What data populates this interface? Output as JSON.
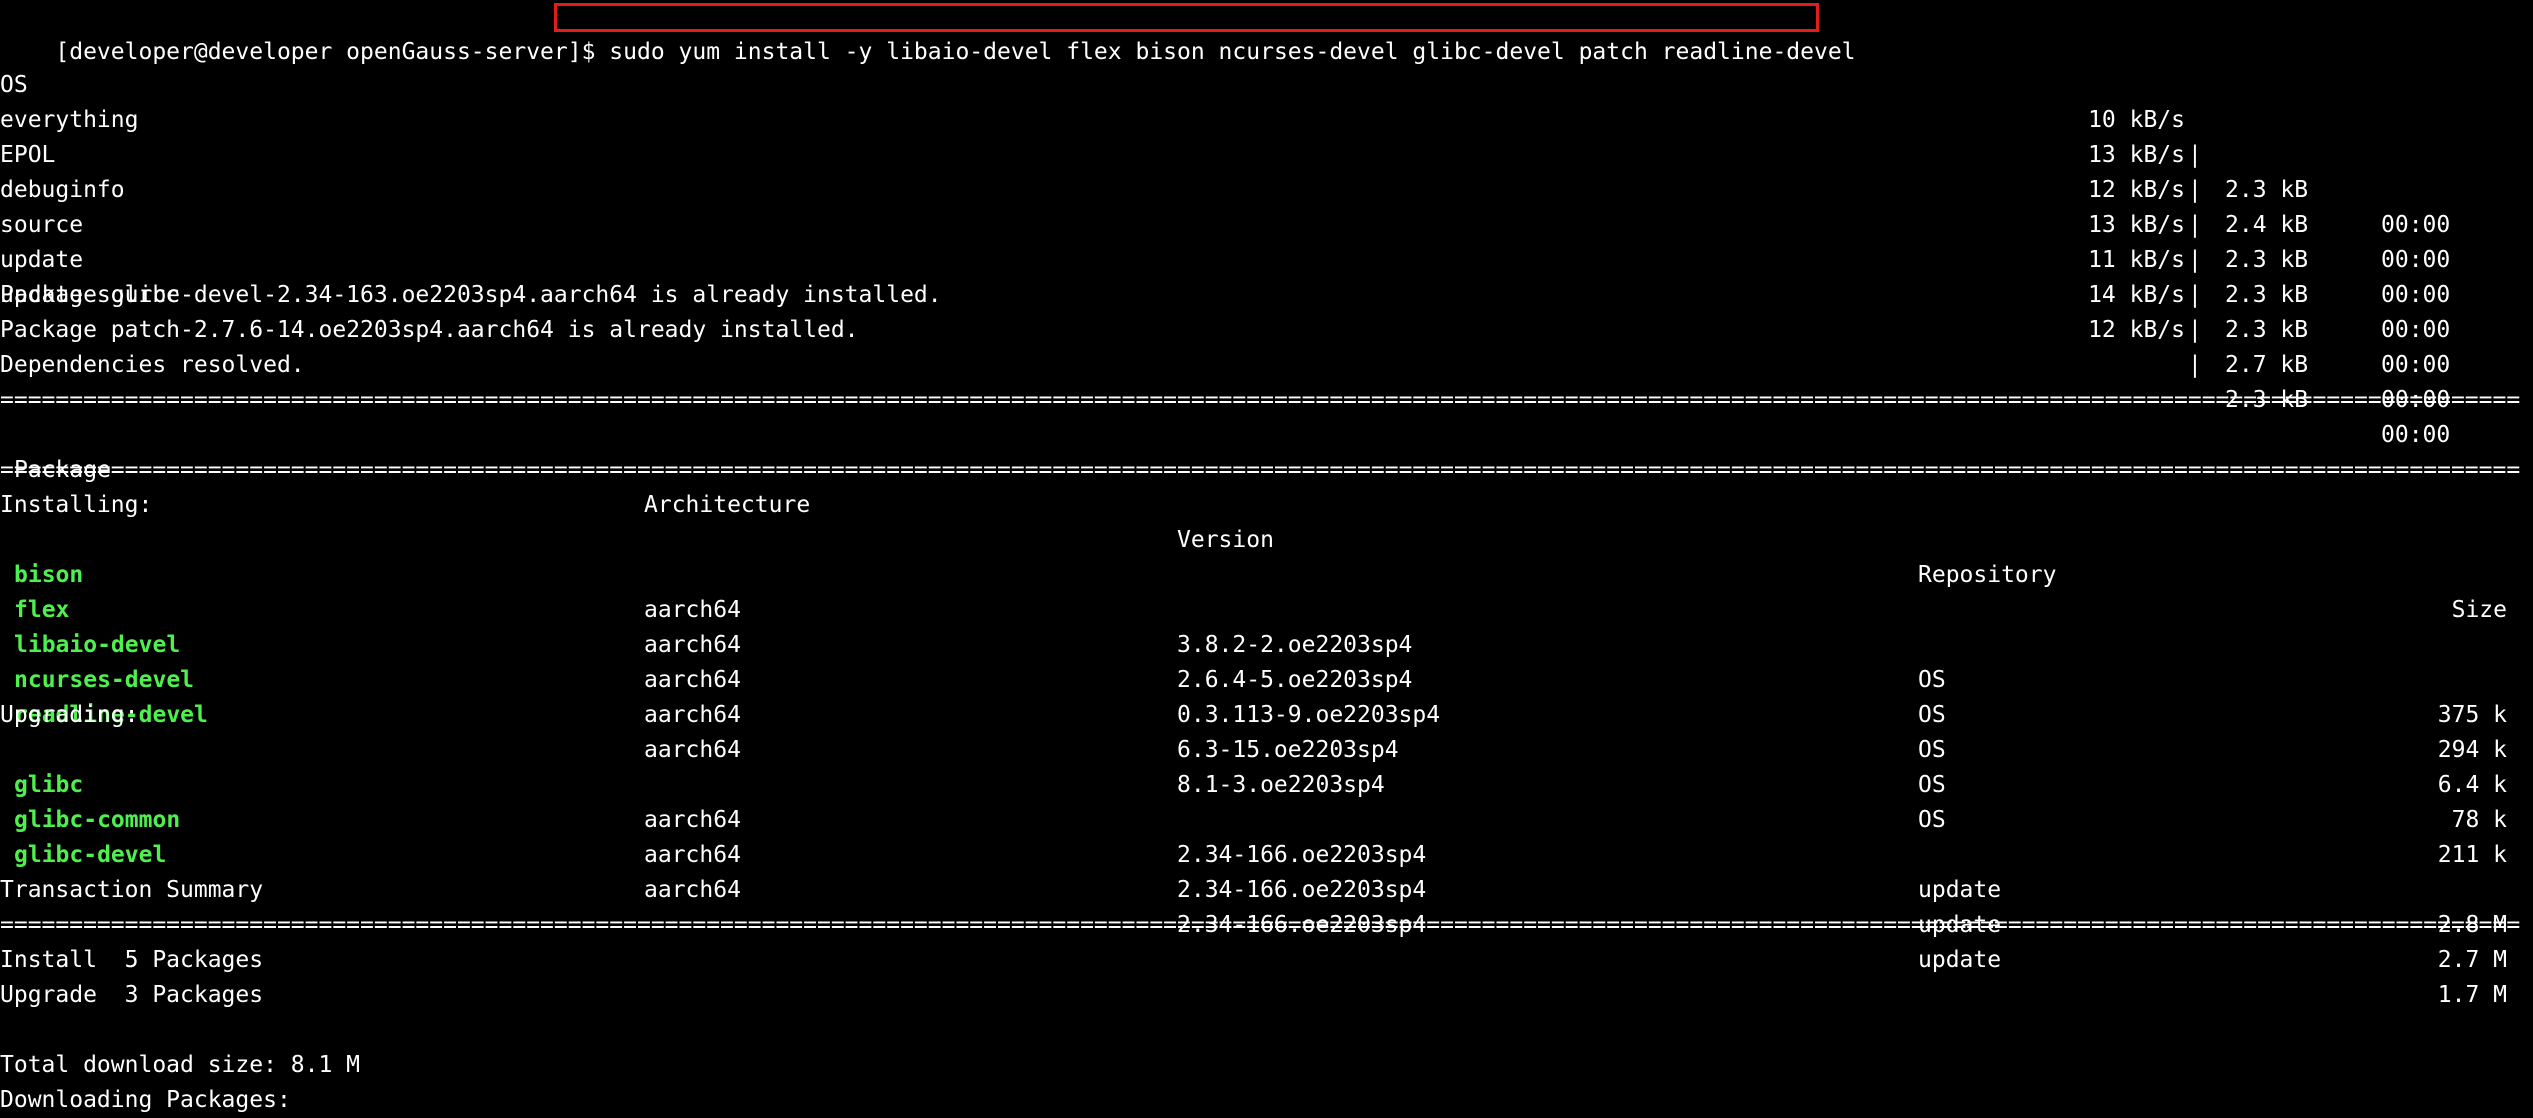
{
  "prompt": {
    "text": "[developer@developer openGauss-server]$ ",
    "command": "sudo yum install -y libaio-devel flex bison ncurses-devel glibc-devel patch readline-devel"
  },
  "repos": [
    {
      "name": "OS",
      "rate": "10 kB/s",
      "size": "2.3 kB",
      "time": "00:00"
    },
    {
      "name": "everything",
      "rate": "13 kB/s",
      "size": "2.4 kB",
      "time": "00:00"
    },
    {
      "name": "EPOL",
      "rate": "12 kB/s",
      "size": "2.3 kB",
      "time": "00:00"
    },
    {
      "name": "debuginfo",
      "rate": "13 kB/s",
      "size": "2.3 kB",
      "time": "00:00"
    },
    {
      "name": "source",
      "rate": "11 kB/s",
      "size": "2.3 kB",
      "time": "00:00"
    },
    {
      "name": "update",
      "rate": "14 kB/s",
      "size": "2.7 kB",
      "time": "00:00"
    },
    {
      "name": "update-source",
      "rate": "12 kB/s",
      "size": "2.3 kB",
      "time": "00:00"
    }
  ],
  "messages": [
    "Package glibc-devel-2.34-163.oe2203sp4.aarch64 is already installed.",
    "Package patch-2.7.6-14.oe2203sp4.aarch64 is already installed.",
    "Dependencies resolved."
  ],
  "rule": "================================================================================================================================================================================================================================================================",
  "table_headers": {
    "package": "Package",
    "architecture": "Architecture",
    "version": "Version",
    "repository": "Repository",
    "size": "Size"
  },
  "installing_label": "Installing:",
  "installing": [
    {
      "package": "bison",
      "arch": "aarch64",
      "version": "3.8.2-2.oe2203sp4",
      "repo": "OS",
      "size": "375 k"
    },
    {
      "package": "flex",
      "arch": "aarch64",
      "version": "2.6.4-5.oe2203sp4",
      "repo": "OS",
      "size": "294 k"
    },
    {
      "package": "libaio-devel",
      "arch": "aarch64",
      "version": "0.3.113-9.oe2203sp4",
      "repo": "OS",
      "size": "6.4 k"
    },
    {
      "package": "ncurses-devel",
      "arch": "aarch64",
      "version": "6.3-15.oe2203sp4",
      "repo": "OS",
      "size": "78 k"
    },
    {
      "package": "readline-devel",
      "arch": "aarch64",
      "version": "8.1-3.oe2203sp4",
      "repo": "OS",
      "size": "211 k"
    }
  ],
  "upgrading_label": "Upgrading:",
  "upgrading": [
    {
      "package": "glibc",
      "arch": "aarch64",
      "version": "2.34-166.oe2203sp4",
      "repo": "update",
      "size": "2.8 M"
    },
    {
      "package": "glibc-common",
      "arch": "aarch64",
      "version": "2.34-166.oe2203sp4",
      "repo": "update",
      "size": "2.7 M"
    },
    {
      "package": "glibc-devel",
      "arch": "aarch64",
      "version": "2.34-166.oe2203sp4",
      "repo": "update",
      "size": "1.7 M"
    }
  ],
  "summary_title": "Transaction Summary",
  "summary": [
    "Install  5 Packages",
    "Upgrade  3 Packages"
  ],
  "total_download": "Total download size: 8.1 M",
  "downloading": "Downloading Packages:",
  "colors": {
    "background": "#000000",
    "text": "#ffffff",
    "package_highlight": "#4ef04e",
    "command_box": "#e31d1d"
  }
}
